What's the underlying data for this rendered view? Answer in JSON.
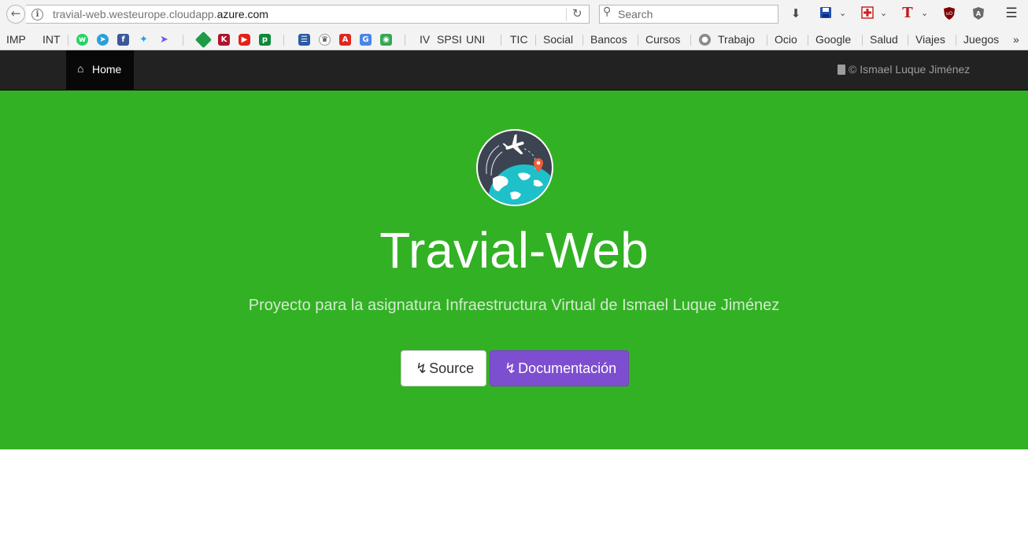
{
  "browser": {
    "url": {
      "prefix": "travial-web.westeurope.cloudapp.",
      "domain": "azure.com"
    },
    "search_placeholder": "Search",
    "toolbar_icons": [
      "downloads-icon",
      "save-icon",
      "red-cross-icon",
      "t-icon",
      "ublock-icon",
      "angular-icon",
      "hamburger-menu-icon"
    ]
  },
  "bookmarks": {
    "group1": [
      "IMP",
      "INT"
    ],
    "group2": [
      "IV",
      "SPSI",
      "UNI"
    ],
    "group3": [
      "TIC",
      "Social",
      "Bancos",
      "Cursos",
      "Trabajo",
      "Ocio",
      "Google",
      "Salud",
      "Viajes",
      "Juegos"
    ],
    "overflow": "»"
  },
  "navbar": {
    "home_label": "Home",
    "copyright": "© Ismael Luque Jiménez"
  },
  "hero": {
    "title": "Travial-Web",
    "subtitle": "Proyecto para la asignatura Infraestructura Virtual de Ismael Luque Jiménez",
    "source_button": "Source",
    "docs_button": "Documentación"
  },
  "colors": {
    "hero_bg": "#32b124",
    "navbar_bg": "#222222",
    "docs_button_bg": "#7e4ed0"
  }
}
